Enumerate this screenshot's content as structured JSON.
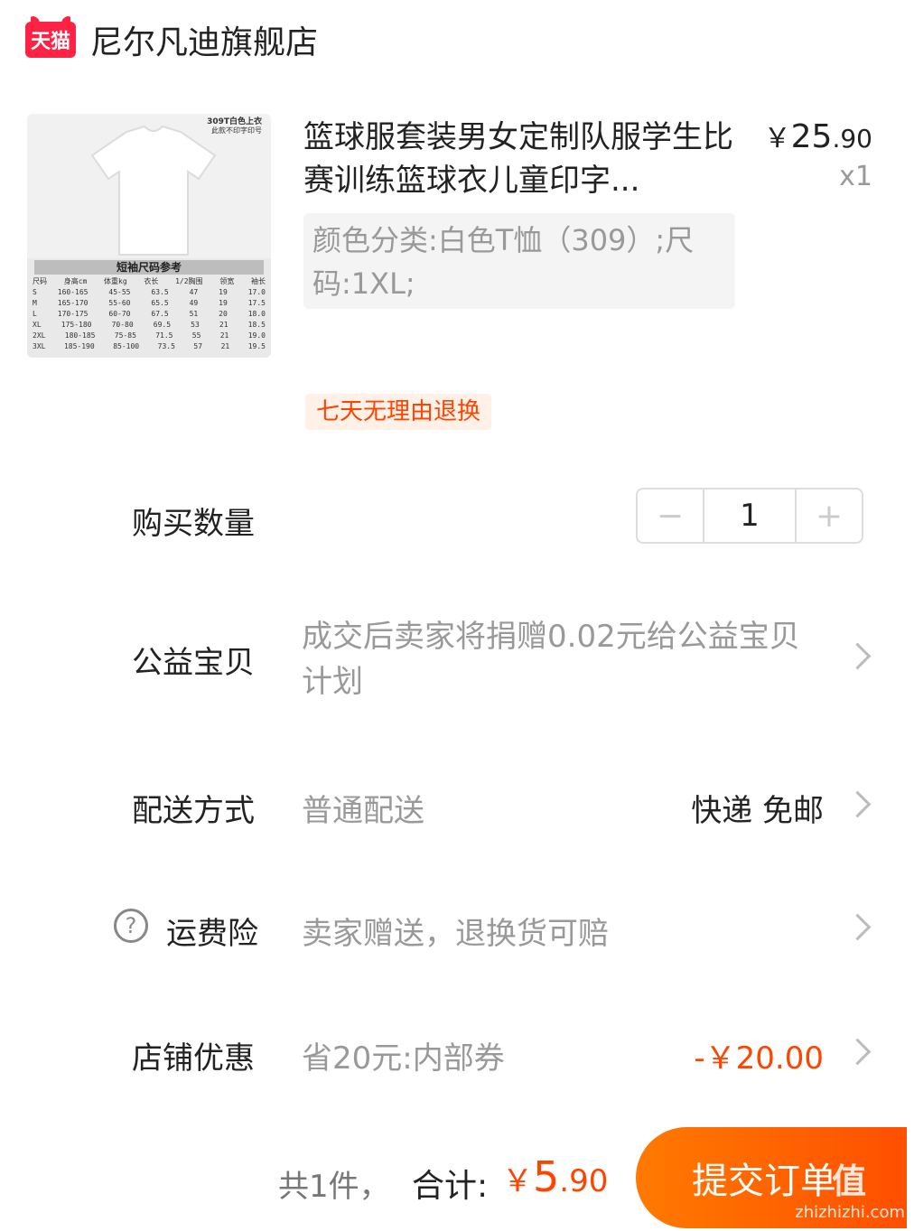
{
  "store": {
    "badge": "天猫",
    "name": "尼尔凡迪旗舰店"
  },
  "product": {
    "image_caption_1": "309T白色上衣",
    "image_caption_2": "此款不印字印号",
    "size_chart_title": "短袖尺码参考",
    "size_chart_header": [
      "尺码",
      "身高cm",
      "体重kg",
      "衣长",
      "1/2胸围",
      "领宽",
      "袖长"
    ],
    "size_chart_rows": [
      [
        "S",
        "160-165",
        "45-55",
        "63.5",
        "47",
        "19",
        "17.0"
      ],
      [
        "M",
        "165-170",
        "55-60",
        "65.5",
        "49",
        "19",
        "17.5"
      ],
      [
        "L",
        "170-175",
        "60-70",
        "67.5",
        "51",
        "20",
        "18.0"
      ],
      [
        "XL",
        "175-180",
        "70-80",
        "69.5",
        "53",
        "21",
        "18.5"
      ],
      [
        "2XL",
        "180-185",
        "75-85",
        "71.5",
        "55",
        "21",
        "19.0"
      ],
      [
        "3XL",
        "185-190",
        "85-100",
        "73.5",
        "57",
        "21",
        "19.5"
      ]
    ],
    "title": "篮球服套装男女定制队服学生比赛训练篮球衣儿童印字...",
    "price_symbol": "￥",
    "price_int": "25",
    "price_dec": ".90",
    "quantity_label": "x1",
    "sku": "颜色分类:白色T恤（309）;尺码:1XL;",
    "return_tag": "七天无理由退换"
  },
  "rows": {
    "quantity": {
      "label": "购买数量",
      "minus": "−",
      "value": "1",
      "plus": "+"
    },
    "charity": {
      "label": "公益宝贝",
      "value": "成交后卖家将捐赠0.02元给公益宝贝计划"
    },
    "delivery": {
      "label": "配送方式",
      "value": "普通配送",
      "right": "快递 免邮"
    },
    "insurance": {
      "icon": "?",
      "label": "运费险",
      "value": "卖家赠送，退换货可赔"
    },
    "discount": {
      "label": "店铺优惠",
      "value": "省20元:内部券",
      "right": "-￥20.00"
    }
  },
  "footer": {
    "count": "共1件，",
    "total_label": "合计:",
    "total_symbol": "￥",
    "total_int": "5",
    "total_dec": ".90",
    "submit": "提交订单",
    "watermark_top": "值",
    "watermark_bottom": "zhizhizhi.com"
  },
  "colors": {
    "accent": "#ff4400",
    "tmall": "#ff2244"
  }
}
